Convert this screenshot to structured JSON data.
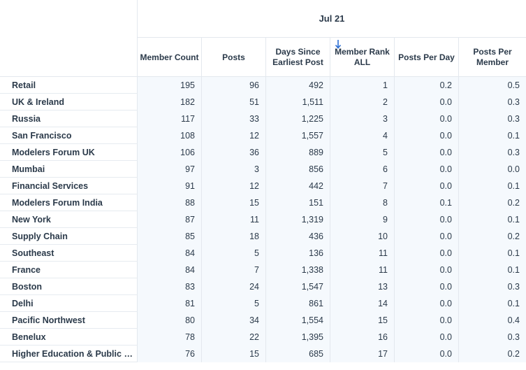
{
  "period_label": "Jul 21",
  "columns": [
    {
      "label": "Member Count"
    },
    {
      "label": "Posts"
    },
    {
      "label": "Days Since Earliest Post"
    },
    {
      "label": "Member Rank ALL"
    },
    {
      "label": "Posts Per Day"
    },
    {
      "label": "Posts Per Member"
    }
  ],
  "sort_icon": "arrow-down-icon",
  "accent_color": "#2b6ed4",
  "rows": [
    {
      "label": "Retail",
      "values": [
        "195",
        "96",
        "492",
        "1",
        "0.2",
        "0.5"
      ]
    },
    {
      "label": "UK & Ireland",
      "values": [
        "182",
        "51",
        "1,511",
        "2",
        "0.0",
        "0.3"
      ]
    },
    {
      "label": "Russia",
      "values": [
        "117",
        "33",
        "1,225",
        "3",
        "0.0",
        "0.3"
      ]
    },
    {
      "label": "San Francisco",
      "values": [
        "108",
        "12",
        "1,557",
        "4",
        "0.0",
        "0.1"
      ]
    },
    {
      "label": "Modelers Forum UK",
      "values": [
        "106",
        "36",
        "889",
        "5",
        "0.0",
        "0.3"
      ]
    },
    {
      "label": "Mumbai",
      "values": [
        "97",
        "3",
        "856",
        "6",
        "0.0",
        "0.0"
      ]
    },
    {
      "label": "Financial Services",
      "values": [
        "91",
        "12",
        "442",
        "7",
        "0.0",
        "0.1"
      ]
    },
    {
      "label": "Modelers Forum India",
      "values": [
        "88",
        "15",
        "151",
        "8",
        "0.1",
        "0.2"
      ]
    },
    {
      "label": "New York",
      "values": [
        "87",
        "11",
        "1,319",
        "9",
        "0.0",
        "0.1"
      ]
    },
    {
      "label": "Supply Chain",
      "values": [
        "85",
        "18",
        "436",
        "10",
        "0.0",
        "0.2"
      ]
    },
    {
      "label": "Southeast",
      "values": [
        "84",
        "5",
        "136",
        "11",
        "0.0",
        "0.1"
      ]
    },
    {
      "label": "France",
      "values": [
        "84",
        "7",
        "1,338",
        "11",
        "0.0",
        "0.1"
      ]
    },
    {
      "label": "Boston",
      "values": [
        "83",
        "24",
        "1,547",
        "13",
        "0.0",
        "0.3"
      ]
    },
    {
      "label": "Delhi",
      "values": [
        "81",
        "5",
        "861",
        "14",
        "0.0",
        "0.1"
      ]
    },
    {
      "label": "Pacific Northwest",
      "values": [
        "80",
        "34",
        "1,554",
        "15",
        "0.0",
        "0.4"
      ]
    },
    {
      "label": "Benelux",
      "values": [
        "78",
        "22",
        "1,395",
        "16",
        "0.0",
        "0.3"
      ]
    },
    {
      "label": "Higher Education & Public S...",
      "values": [
        "76",
        "15",
        "685",
        "17",
        "0.0",
        "0.2"
      ]
    }
  ]
}
